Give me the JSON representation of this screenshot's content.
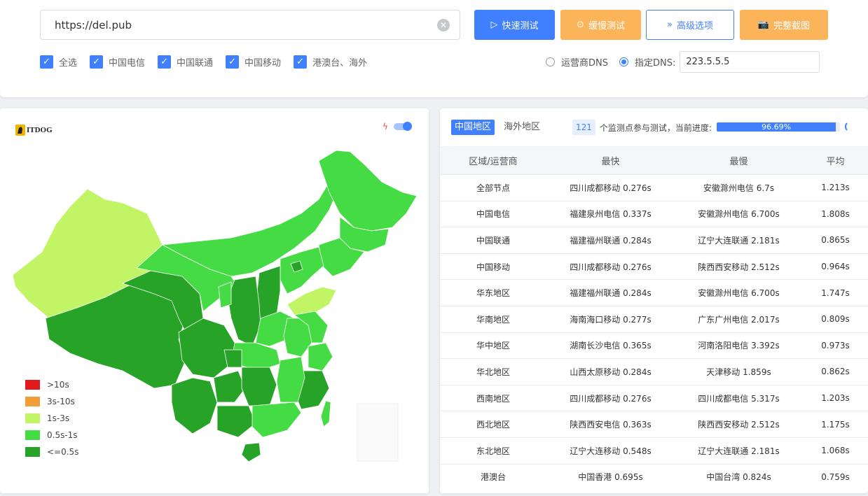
{
  "url": {
    "value": "https://del.pub"
  },
  "buttons": {
    "fast": "快速测试",
    "slow": "缓慢测试",
    "advanced": "高级选项",
    "screenshot": "完整截图"
  },
  "checkboxes": [
    {
      "label": "全选",
      "checked": true
    },
    {
      "label": "中国电信",
      "checked": true
    },
    {
      "label": "中国联通",
      "checked": true
    },
    {
      "label": "中国移动",
      "checked": true
    },
    {
      "label": "港澳台、海外",
      "checked": true
    }
  ],
  "dns": {
    "option1": "运营商DNS",
    "option2": "指定DNS:",
    "selected": "option2",
    "value": "223.5.5.5"
  },
  "map": {
    "logo": "ITDOG",
    "toggle_on": true,
    "legend": [
      {
        "label": ">10s",
        "color": "#e31a1c"
      },
      {
        "label": "3s-10s",
        "color": "#f39c3a"
      },
      {
        "label": "1s-3s",
        "color": "#c2f566"
      },
      {
        "label": "0.5s-1s",
        "color": "#44db44"
      },
      {
        "label": "<=0.5s",
        "color": "#27a327"
      }
    ]
  },
  "results": {
    "tabs": [
      {
        "label": "中国地区",
        "active": true
      },
      {
        "label": "海外地区",
        "active": false
      }
    ],
    "node_count": "121",
    "node_text": "个监测点参与测试，当前进度:",
    "progress_label": "96.69%",
    "progress_value": 96.69,
    "columns": [
      "区域/运营商",
      "最快",
      "最慢",
      "平均"
    ],
    "rows": [
      [
        "全部节点",
        "四川成都移动 0.276s",
        "安徽滁州电信 6.7s",
        "1.213s"
      ],
      [
        "中国电信",
        "福建泉州电信 0.337s",
        "安徽滁州电信 6.700s",
        "1.808s"
      ],
      [
        "中国联通",
        "福建福州联通 0.284s",
        "辽宁大连联通 2.181s",
        "0.865s"
      ],
      [
        "中国移动",
        "四川成都移动 0.276s",
        "陕西西安移动 2.512s",
        "0.964s"
      ],
      [
        "华东地区",
        "福建福州联通 0.284s",
        "安徽滁州电信 6.700s",
        "1.747s"
      ],
      [
        "华南地区",
        "海南海口移动 0.277s",
        "广东广州电信 2.017s",
        "0.809s"
      ],
      [
        "华中地区",
        "湖南长沙电信 0.365s",
        "河南洛阳电信 3.392s",
        "0.973s"
      ],
      [
        "华北地区",
        "山西太原移动 0.284s",
        "天津移动 1.859s",
        "0.862s"
      ],
      [
        "西南地区",
        "四川成都移动 0.276s",
        "四川成都电信 5.317s",
        "1.203s"
      ],
      [
        "西北地区",
        "陕西西安电信 0.363s",
        "陕西西安移动 2.512s",
        "1.175s"
      ],
      [
        "东北地区",
        "辽宁大连移动 0.548s",
        "辽宁大连联通 2.181s",
        "1.068s"
      ],
      [
        "港澳台",
        "中国香港 0.695s",
        "中国台湾 0.824s",
        "0.759s"
      ]
    ]
  }
}
